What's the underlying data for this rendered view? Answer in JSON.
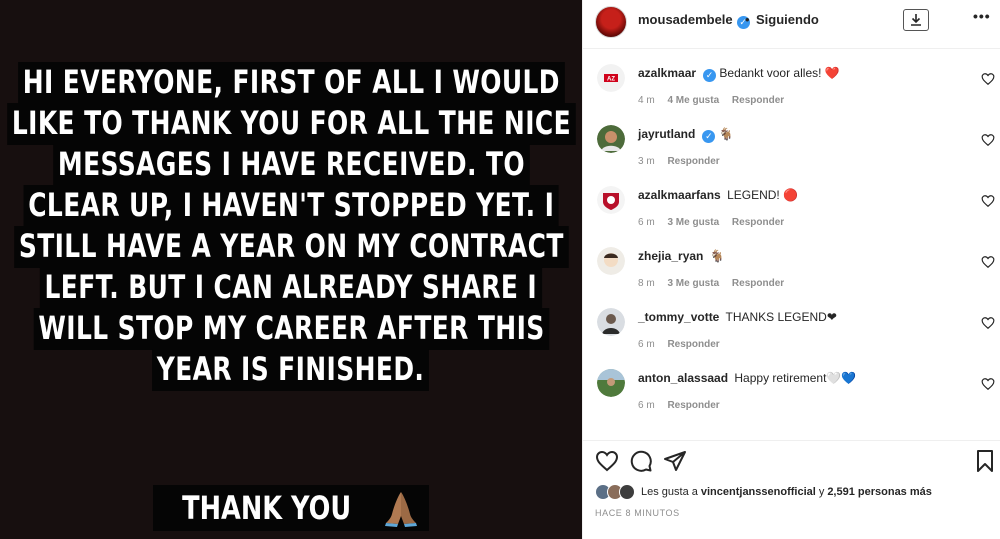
{
  "story": {
    "lines": [
      "HI EVERYONE, FIRST OF ALL I WOULD",
      "LIKE TO THANK YOU FOR ALL THE NICE",
      "MESSAGES I HAVE RECEIVED. TO",
      "CLEAR UP, I HAVEN'T STOPPED YET. I",
      "STILL HAVE A YEAR ON MY CONTRACT",
      "LEFT. BUT I CAN ALREADY SHARE I",
      "WILL STOP MY CAREER AFTER THIS",
      "YEAR IS FINISHED."
    ],
    "thanks": "THANK YOU",
    "thanks_emoji": "praying-hands-icon"
  },
  "header": {
    "username": "mousadembele",
    "verified": true,
    "separator": "•",
    "follow_status": "Siguiendo",
    "download_icon": "download-icon",
    "more_icon": "more-options-icon"
  },
  "comments": [
    {
      "user": "azalkmaar",
      "verified": true,
      "text": "Bedankt voor alles! ❤️",
      "time": "4 m",
      "likes": "4 Me gusta",
      "reply": "Responder"
    },
    {
      "user": "jayrutland",
      "verified": true,
      "text": "🐐",
      "time": "3 m",
      "likes": "",
      "reply": "Responder"
    },
    {
      "user": "azalkmaarfans",
      "verified": false,
      "text": "LEGEND! 🔴",
      "time": "6 m",
      "likes": "3 Me gusta",
      "reply": "Responder"
    },
    {
      "user": "zhejia_ryan",
      "verified": false,
      "text": "🐐",
      "time": "8 m",
      "likes": "3 Me gusta",
      "reply": "Responder"
    },
    {
      "user": "_tommy_votte",
      "verified": false,
      "text": "THANKS LEGEND❤",
      "time": "6 m",
      "likes": "",
      "reply": "Responder"
    },
    {
      "user": "anton_alassaad",
      "verified": false,
      "text": "Happy retirement🤍💙",
      "time": "6 m",
      "likes": "",
      "reply": "Responder"
    }
  ],
  "likes": {
    "prefix": "Les gusta a",
    "user": "vincentjanssenofficial",
    "middle": "y",
    "others": "2,591 personas más"
  },
  "timestamp": "HACE 8 MINUTOS",
  "colors": {
    "story_bg": "#170f0f",
    "verified": "#3897f0",
    "meta": "#8e8e8e"
  }
}
